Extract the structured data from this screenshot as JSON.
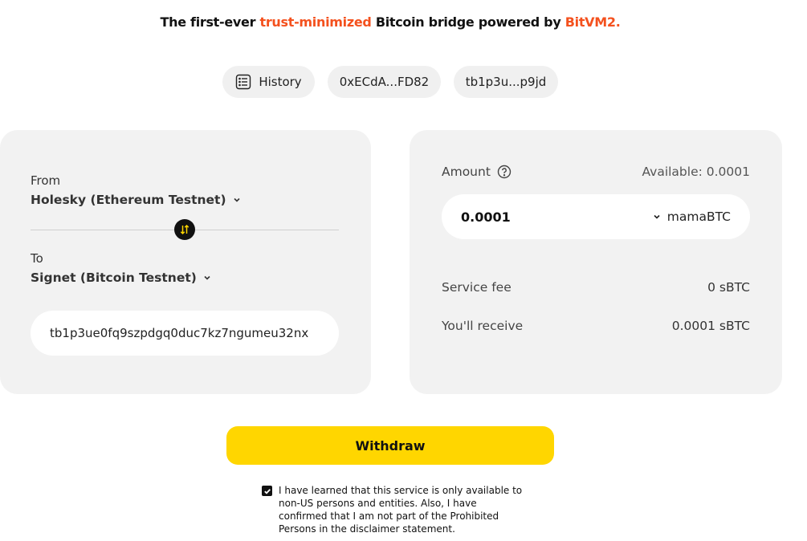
{
  "headline": {
    "prefix": "The first-ever ",
    "accent": "trust-minimized",
    "middle": " Bitcoin bridge powered by ",
    "brand": "BitVM2."
  },
  "colors": {
    "accent": "#f4511e",
    "button": "#ffd600",
    "card": "#f2f2f2"
  },
  "top_pills": {
    "history": {
      "label": "History",
      "icon": "history-list-icon"
    },
    "eth_wallet": "0xECdA...FD82",
    "btc_wallet": "tb1p3u...p9jd"
  },
  "source": {
    "from_label": "From",
    "from_network": "Holesky (Ethereum Testnet)",
    "to_label": "To",
    "to_network": "Signet (Bitcoin Testnet)",
    "swap_icon": "swap-arrows-icon",
    "address_value": "tb1p3ue0fq9szpdgq0duc7kz7ngumeu32nx"
  },
  "amount_panel": {
    "amount_label": "Amount",
    "help_icon": "question-circle-icon",
    "available": "Available: 0.0001",
    "amount_value": "0.0001",
    "token": "mamaBTC",
    "service_fee_label": "Service fee",
    "service_fee_value": "0 sBTC",
    "receive_label": "You'll receive",
    "receive_value": "0.0001 sBTC"
  },
  "withdraw_label": "Withdraw",
  "disclaimer": {
    "checked": true,
    "text": "I have learned that this service is only available to non-US persons and entities. Also, I have confirmed that I am not part of the Prohibited Persons in the disclaimer statement."
  }
}
